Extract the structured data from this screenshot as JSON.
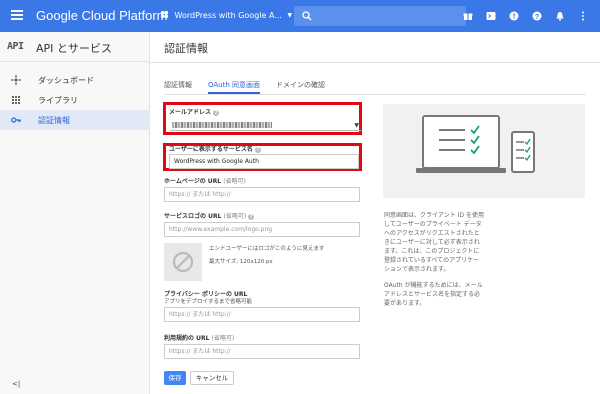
{
  "topbar": {
    "brand": "Google Cloud Platform",
    "project": "WordPress with Google A...",
    "icons": [
      "gift-icon",
      "terminal-icon",
      "alert-icon",
      "help-icon",
      "bell-icon",
      "more-icon"
    ]
  },
  "sidebar": {
    "api_logo": "API",
    "title": "API とサービス",
    "items": [
      {
        "label": "ダッシュボード",
        "icon": "dashboard-icon",
        "active": false
      },
      {
        "label": "ライブラリ",
        "icon": "library-icon",
        "active": false
      },
      {
        "label": "認証情報",
        "icon": "key-icon",
        "active": true
      }
    ],
    "collapse": "<|"
  },
  "main": {
    "title": "認証情報",
    "tabs": [
      {
        "label": "認証情報",
        "active": false
      },
      {
        "label": "OAuth 同意画面",
        "active": true
      },
      {
        "label": "ドメインの確認",
        "active": false
      }
    ]
  },
  "form": {
    "email_label": "メールアドレス",
    "product_label": "ユーザーに表示するサービス名",
    "product_value": "WordPress with Google Auth",
    "homepage_label": "ホームページの URL",
    "homepage_optional": "(省略可)",
    "homepage_placeholder": "https:// または http://",
    "logo_label": "サービスロゴの URL",
    "logo_optional": "(省略可)",
    "logo_placeholder": "http://www.example.com/logo.png",
    "logo_note_1": "エンドユーザーにはロゴがこのように見えます",
    "logo_note_2": "最大サイズ: 120x120 px",
    "privacy_label": "プライバシー ポリシーの URL",
    "privacy_sub": "アプリをデプロイするまで省略可能",
    "privacy_placeholder": "https:// または http://",
    "terms_label": "利用規約の URL",
    "terms_optional": "(省略可)",
    "terms_placeholder": "https:// または http://",
    "save": "保存",
    "cancel": "キャンセル"
  },
  "info": {
    "para1_lines": [
      "同意画面は、クライアント ID を使用",
      "してユーザーのプライベート データ",
      "へのアクセスがリクエストされたと",
      "きにユーザーに対して必ず表示され",
      "ます。これは、このプロジェクトに",
      "登録されているすべてのアプリケー",
      "ションで表示されます。"
    ],
    "para2_lines": [
      "OAuth が機能するためには、メール",
      "アドレスとサービス名を指定する必",
      "要があります。"
    ]
  },
  "colors": {
    "topbar": "#3b78e7",
    "accent": "#3367d6",
    "highlight": "#e30613",
    "check": "#1a9e73"
  }
}
